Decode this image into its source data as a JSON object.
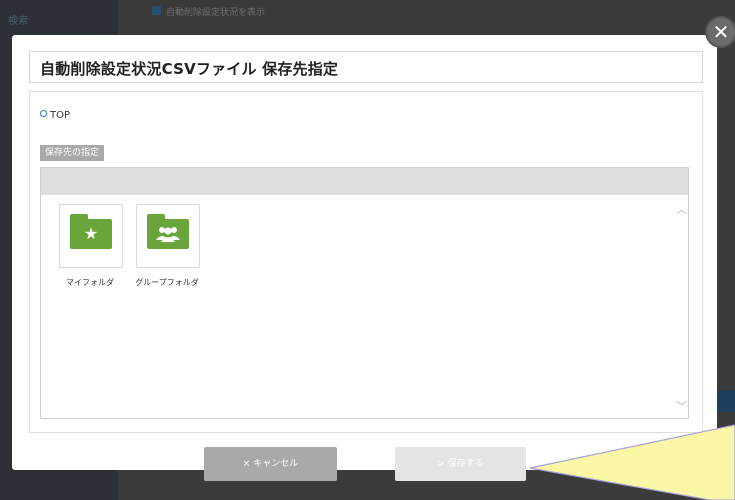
{
  "background": {
    "sidebar_text": "検索",
    "strip_text": "自動削除設定状況を表示"
  },
  "modal": {
    "title": "自動削除設定状況CSVファイル 保存先指定",
    "close_icon": "close-icon",
    "breadcrumb": "TOP",
    "section_label": "保存先の指定",
    "folders": [
      {
        "label": "マイフォルダ",
        "icon": "star-icon"
      },
      {
        "label": "グループフォルダ",
        "icon": "group-icon"
      }
    ],
    "cancel_label": "× キャンセル",
    "save_label": "> 保存する"
  },
  "colors": {
    "folder_green": "#6aa53b",
    "breadcrumb_blue": "#2b7fbf",
    "cancel_gray": "#a9a9a9",
    "save_disabled": "#e4e4e4",
    "tooltip_yellow": "#fbf7a6"
  }
}
